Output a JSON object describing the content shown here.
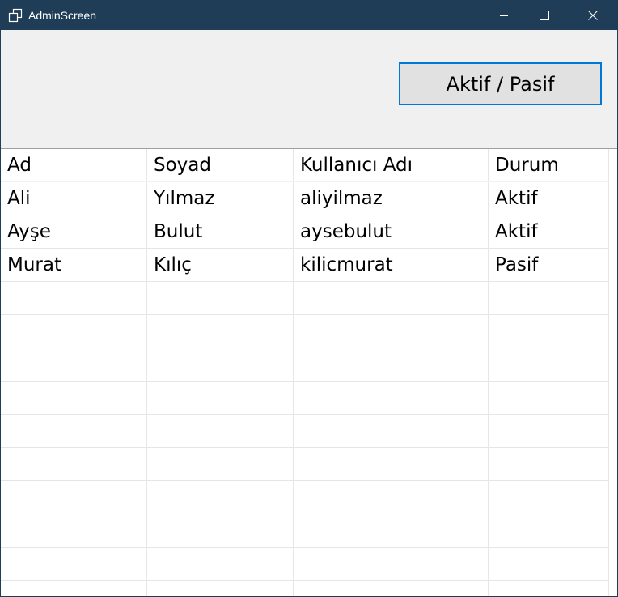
{
  "window": {
    "title": "AdminScreen",
    "controls": [
      "minimize-icon",
      "maximize-icon",
      "close-icon"
    ]
  },
  "toolbar": {
    "toggle_label": "Aktif / Pasif"
  },
  "grid": {
    "headers": [
      "Ad",
      "Soyad",
      "Kullanıcı Adı",
      "Durum"
    ],
    "rows": [
      [
        "Ali",
        "Yılmaz",
        "aliyilmaz",
        "Aktif"
      ],
      [
        "Ayşe",
        "Bulut",
        "aysebulut",
        "Aktif"
      ],
      [
        "Murat",
        "Kılıç",
        "kilicmurat",
        "Pasif"
      ]
    ]
  },
  "colors": {
    "titlebar": "#1f3d56",
    "button_border": "#0078d7",
    "button_bg": "#e1e1e1",
    "background": "#f0f0f0"
  }
}
